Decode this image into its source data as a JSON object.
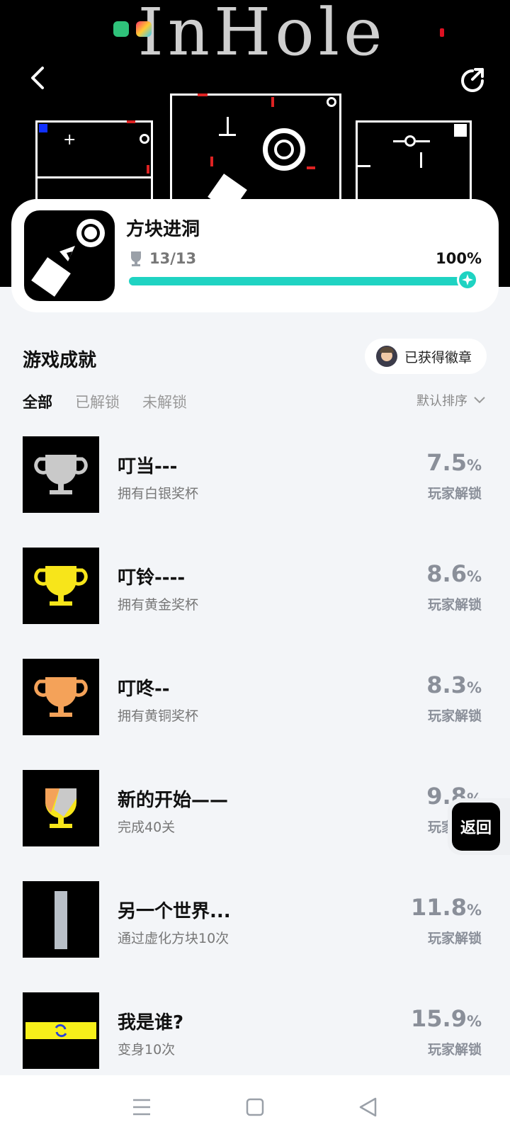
{
  "hero": {
    "title": "InHole"
  },
  "game": {
    "name": "方块进洞",
    "trophy_count": "13/13",
    "progress_text": "100%",
    "progress_fraction": 1.0,
    "accent_color": "#1fd3c2"
  },
  "section": {
    "title": "游戏成就",
    "badge_label": "已获得徽章"
  },
  "tabs": [
    {
      "label": "全部",
      "active": true
    },
    {
      "label": "已解锁",
      "active": false
    },
    {
      "label": "未解锁",
      "active": false
    }
  ],
  "sort_label": "默认排序",
  "achievements": [
    {
      "name": "叮当---",
      "desc": "拥有白银奖杯",
      "pct": "7.5",
      "sub": "玩家解锁",
      "icon": "silver-trophy-icon"
    },
    {
      "name": "叮铃----",
      "desc": "拥有黄金奖杯",
      "pct": "8.6",
      "sub": "玩家解锁",
      "icon": "gold-trophy-icon"
    },
    {
      "name": "叮咚--",
      "desc": "拥有黄铜奖杯",
      "pct": "8.3",
      "sub": "玩家解锁",
      "icon": "bronze-trophy-icon"
    },
    {
      "name": "新的开始——",
      "desc": "完成40关",
      "pct": "9.8",
      "sub": "玩家解锁",
      "icon": "mixed-trophy-icon"
    },
    {
      "name": "另一个世界...",
      "desc": "通过虚化方块10次",
      "pct": "11.8",
      "sub": "玩家解锁",
      "icon": "gray-bar-icon"
    },
    {
      "name": "我是谁?",
      "desc": "变身10次",
      "pct": "15.9",
      "sub": "玩家解锁",
      "icon": "transform-bar-icon"
    }
  ],
  "percent_unit": "%",
  "float_back_label": "返回"
}
